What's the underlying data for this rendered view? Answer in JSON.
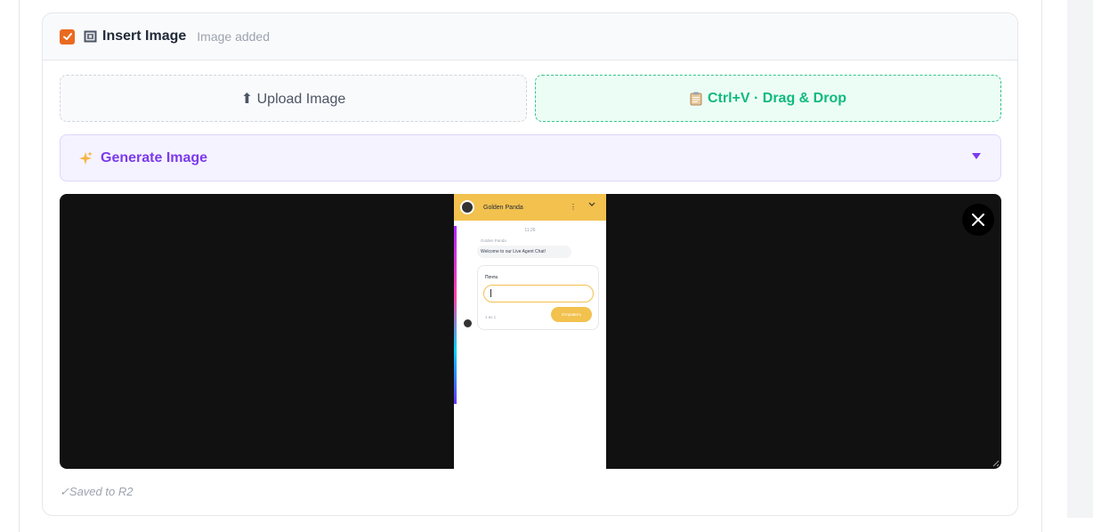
{
  "section": {
    "title": "Insert Image",
    "status": "Image added",
    "checkbox_checked": true,
    "icon": "image-frame-icon"
  },
  "buttons": {
    "upload_label": "⬆ Upload Image",
    "paste_label": "Ctrl+V · Drag & Drop",
    "paste_icon": "clipboard-icon"
  },
  "generate": {
    "label": "Generate Image",
    "icon": "sparkles-icon",
    "caret": "caret-down-icon"
  },
  "preview": {
    "close_icon": "close-icon",
    "screenshot": {
      "brand": "Golden Panda",
      "time": "11:26",
      "sender": "Golden Panda",
      "message": "Welcome to our Live Agent Chat!",
      "form_label": "Почта",
      "step_count": "1 из 1",
      "send_label": "Отправить"
    }
  },
  "footer": {
    "saved_text": "✓Saved to R2"
  },
  "colors": {
    "accent_orange": "#ea6a1f",
    "green": "#10b981",
    "purple": "#7c3aed",
    "widget_yellow": "#f2c14e"
  }
}
